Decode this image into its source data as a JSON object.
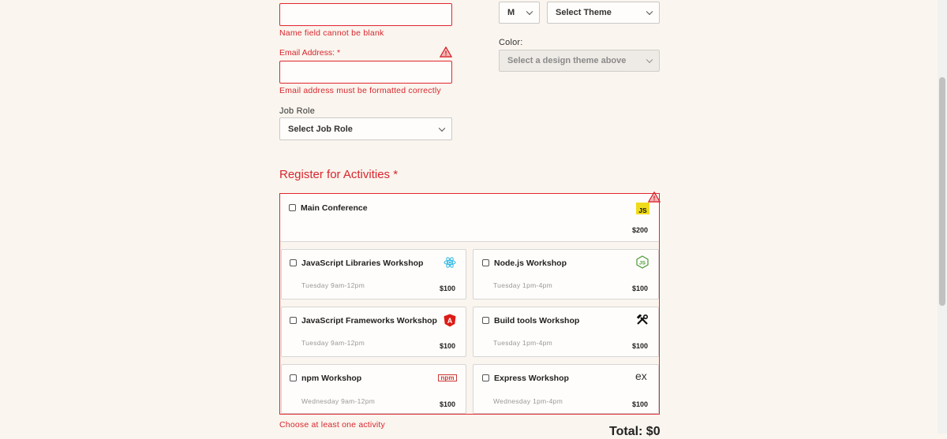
{
  "name_field": {
    "value": "",
    "error": "Name field cannot be blank"
  },
  "email_field": {
    "label": "Email Address:",
    "required_mark": "*",
    "value": "",
    "error": "Email address must be formatted correctly"
  },
  "job_role": {
    "label": "Job Role",
    "selected": "Select Job Role"
  },
  "tshirt": {
    "size_selected": "M",
    "theme_selected": "Select Theme",
    "color_label": "Color:",
    "color_selected": "Select a design theme above"
  },
  "activities": {
    "heading": "Register for Activities",
    "required_mark": "*",
    "error": "Choose at least one activity",
    "main": {
      "title": "Main Conference",
      "price": "$200",
      "icon_text": "JS"
    },
    "items": [
      {
        "title": "JavaScript Libraries Workshop",
        "time": "Tuesday 9am-12pm",
        "price": "$100",
        "icon": "react-icon"
      },
      {
        "title": "Node.js Workshop",
        "time": "Tuesday 1pm-4pm",
        "price": "$100",
        "icon": "nodejs-icon"
      },
      {
        "title": "JavaScript Frameworks Workshop",
        "time": "Tuesday 9am-12pm",
        "price": "$100",
        "icon": "angular-icon",
        "icon_text": "A"
      },
      {
        "title": "Build tools Workshop",
        "time": "Tuesday 1pm-4pm",
        "price": "$100",
        "icon": "tools-icon"
      },
      {
        "title": "npm Workshop",
        "time": "Wednesday 9am-12pm",
        "price": "$100",
        "icon": "npm-icon",
        "icon_text": "npm"
      },
      {
        "title": "Express Workshop",
        "time": "Wednesday 1pm-4pm",
        "price": "$100",
        "icon": "express-icon",
        "icon_text": "ex"
      }
    ],
    "total": "Total: $0"
  },
  "colors": {
    "error": "#e0262e",
    "background": "#faf5ee"
  }
}
